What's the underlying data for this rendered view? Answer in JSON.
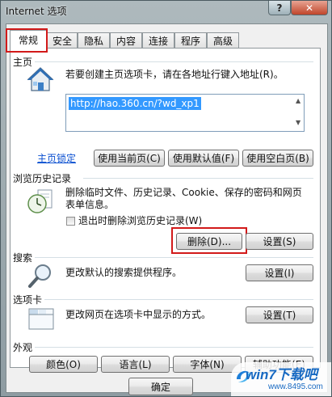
{
  "window": {
    "title": "Internet 选项",
    "help_label": "?",
    "close_label": "✕"
  },
  "tabs": [
    {
      "label": "常规",
      "active": true
    },
    {
      "label": "安全"
    },
    {
      "label": "隐私"
    },
    {
      "label": "内容"
    },
    {
      "label": "连接"
    },
    {
      "label": "程序"
    },
    {
      "label": "高级"
    }
  ],
  "homepage": {
    "section_title": "主页",
    "description": "若要创建主页选项卡，请在各地址行键入地址(R)。",
    "url": "http://hao.360.cn/?wd_xp1",
    "lock_link": "主页锁定",
    "buttons": [
      "使用当前页(C)",
      "使用默认值(F)",
      "使用空白页(B)"
    ]
  },
  "history": {
    "section_title": "浏览历史记录",
    "description_line1": "删除临时文件、历史记录、Cookie、保存的密码和网页",
    "description_line2": "表单信息。",
    "checkbox_label": "退出时删除浏览历史记录(W)",
    "checkbox_checked": false,
    "delete_button": "删除(D)...",
    "settings_button": "设置(S)"
  },
  "search": {
    "section_title": "搜索",
    "description": "更改默认的搜索提供程序。",
    "settings_button": "设置(I)"
  },
  "tabs_section": {
    "section_title": "选项卡",
    "description": "更改网页在选项卡中显示的方式。",
    "settings_button": "设置(T)"
  },
  "appearance": {
    "section_title": "外观",
    "buttons": [
      "颜色(O)",
      "语言(L)",
      "字体(N)",
      "辅助功能(E)"
    ]
  },
  "dialog_buttons": {
    "ok": "确定"
  },
  "watermark": {
    "logo_text": "win7下载吧",
    "url": "www.8495.com"
  },
  "icons": {
    "home": "house-icon",
    "history": "clock-document-icon",
    "search": "magnifier-icon",
    "tabs": "tab-window-icon"
  },
  "colors": {
    "highlight_red": "#d21a1a",
    "selection_blue": "#3399ff",
    "link_blue": "#0a4fd0"
  }
}
